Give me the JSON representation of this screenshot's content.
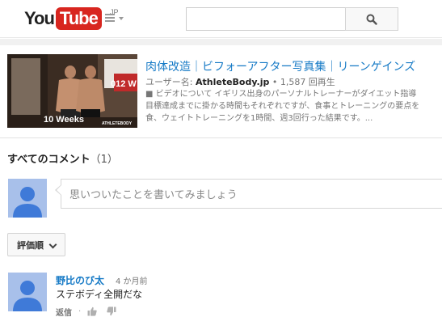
{
  "header": {
    "logo_you": "You",
    "logo_tube": "Tube",
    "logo_region": "JP",
    "search": {
      "value": "",
      "placeholder": ""
    }
  },
  "video": {
    "thumbnail_caption": "10 Weeks",
    "thumbnail_brand": "ATHLETEBODY",
    "thumbnail_sign": "012 W",
    "title": "肉体改造｜ビフォーアフター写真集｜リーンゲインズ",
    "meta_prefix": "ユーザー名: ",
    "channel": "AthleteBody.jp",
    "meta_views": " • 1,587 回再生",
    "description_lines": [
      "■ ビデオについて イギリス出身のパーソナルトレーナーがダイエット指導",
      "目標達成までに掛かる時間もそれぞれですが、食事とトレーニングの要点を",
      "食、ウェイトトレーニングを1時間、週3回行った結果です。..."
    ]
  },
  "comments": {
    "heading": "すべてのコメント",
    "count": "（1）",
    "compose_placeholder": "思いついたことを書いてみましょう",
    "sort_label": "評価順",
    "items": [
      {
        "author": "野比のび太",
        "time": "4 か月前",
        "text": "ステボディ全開だな",
        "reply_label": "返信",
        "separator": "·"
      }
    ]
  },
  "colors": {
    "brand_red": "#d8261f",
    "link_blue": "#167ac6",
    "avatar_bg": "#a8c0ea",
    "avatar_fg": "#3f7ad8"
  }
}
